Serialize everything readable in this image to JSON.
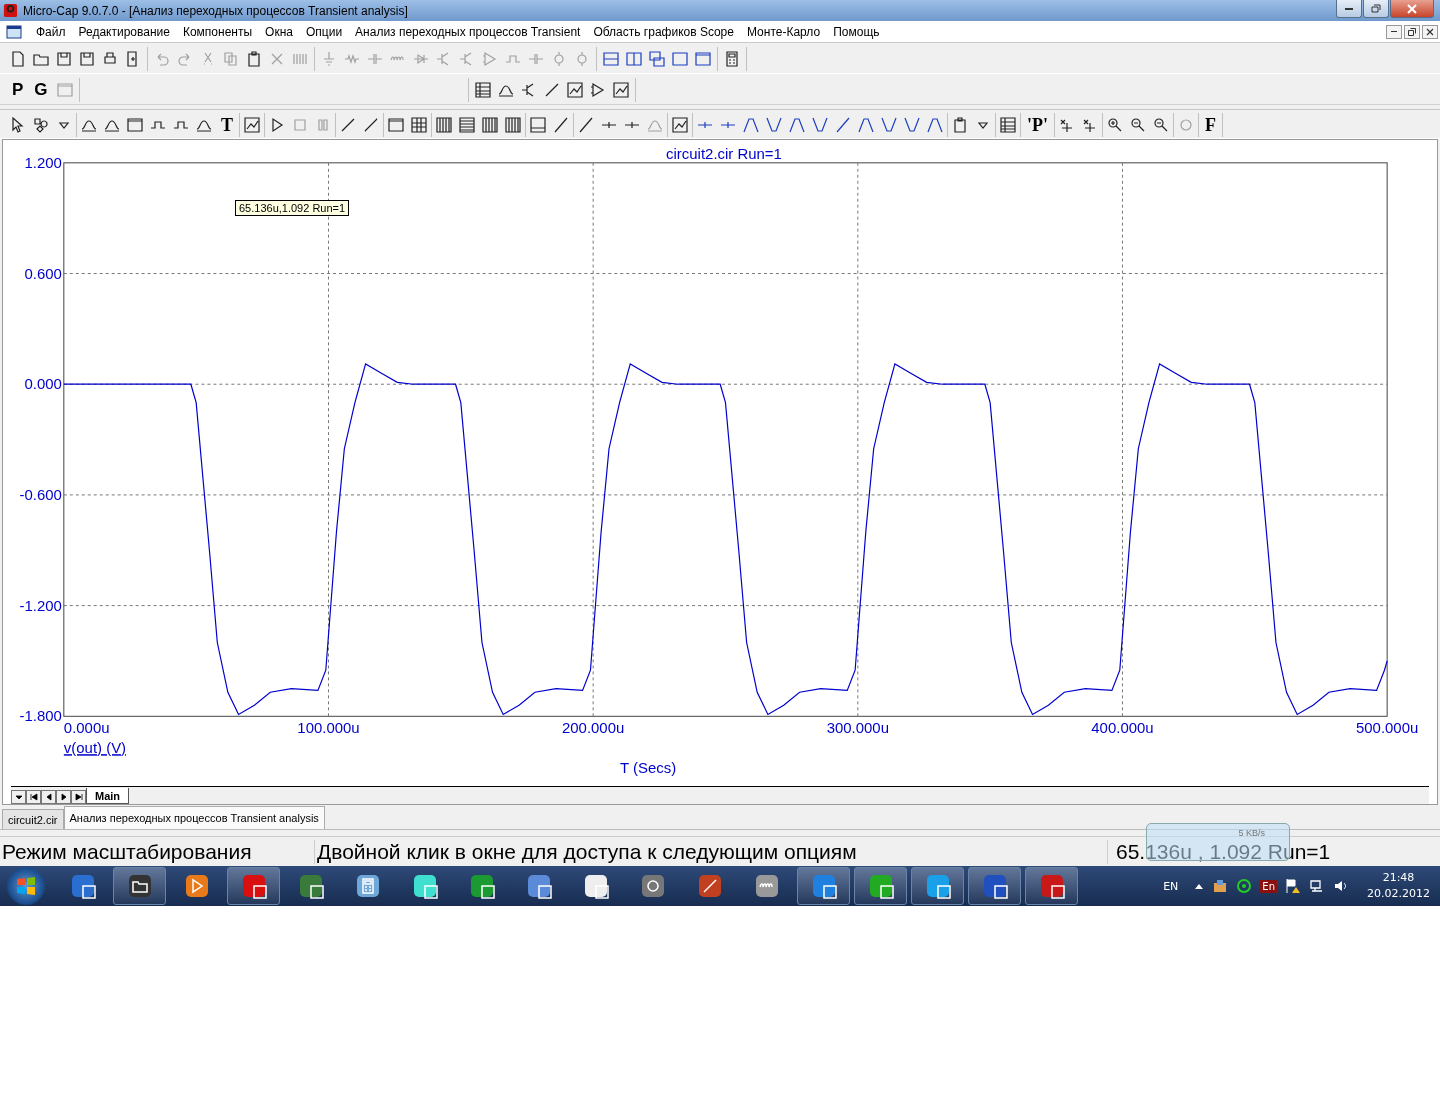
{
  "window": {
    "title": "Micro-Cap 9.0.7.0 - [Анализ переходных процессов Transient analysis]"
  },
  "menu": [
    "Файл",
    "Редактирование",
    "Компоненты",
    "Окна",
    "Опции",
    "Анализ переходных процессов Transient",
    "Область графиков Scope",
    "Монте-Карло",
    "Помощь"
  ],
  "mode_toolbar": {
    "buttons": [
      "P",
      "G"
    ]
  },
  "plot_toolbar": {
    "text_buttons": [
      "T",
      "'P'",
      "F"
    ]
  },
  "plot": {
    "tooltip": "65.136u,1.092 Run=1",
    "chart_data": {
      "type": "line",
      "title": "circuit2.cir Run=1",
      "xlabel": "T (Secs)",
      "x": [
        0,
        48,
        50,
        55,
        58,
        62,
        66,
        72,
        78,
        86,
        96,
        99,
        103,
        106,
        110,
        114,
        120,
        126,
        132,
        148,
        150,
        155,
        158,
        162,
        166,
        172,
        178,
        186,
        196,
        199,
        203,
        206,
        210,
        214,
        220,
        226,
        232,
        248,
        250,
        255,
        258,
        262,
        266,
        272,
        278,
        286,
        296,
        299,
        303,
        306,
        310,
        314,
        320,
        326,
        332,
        348,
        350,
        355,
        358,
        362,
        366,
        372,
        378,
        386,
        396,
        399,
        403,
        406,
        410,
        414,
        420,
        426,
        432,
        448,
        450,
        455,
        458,
        462,
        466,
        472,
        478,
        486,
        496,
        499,
        500
      ],
      "series": [
        {
          "name": "v(out) (V)",
          "color": "#0000cc",
          "values": [
            0,
            0,
            -0.1,
            -0.9,
            -1.4,
            -1.67,
            -1.79,
            -1.74,
            -1.67,
            -1.65,
            -1.66,
            -1.55,
            -0.8,
            -0.35,
            -0.1,
            0.11,
            0.06,
            0.01,
            0,
            0,
            -0.1,
            -0.9,
            -1.4,
            -1.67,
            -1.79,
            -1.74,
            -1.67,
            -1.65,
            -1.66,
            -1.55,
            -0.8,
            -0.35,
            -0.1,
            0.11,
            0.06,
            0.01,
            0,
            0,
            -0.1,
            -0.9,
            -1.4,
            -1.67,
            -1.79,
            -1.74,
            -1.67,
            -1.65,
            -1.66,
            -1.55,
            -0.8,
            -0.35,
            -0.1,
            0.11,
            0.06,
            0.01,
            0,
            0,
            -0.1,
            -0.9,
            -1.4,
            -1.67,
            -1.79,
            -1.74,
            -1.67,
            -1.65,
            -1.66,
            -1.55,
            -0.8,
            -0.35,
            -0.1,
            0.11,
            0.06,
            0.01,
            0,
            0,
            -0.1,
            -0.9,
            -1.4,
            -1.67,
            -1.79,
            -1.74,
            -1.67,
            -1.65,
            -1.66,
            -1.55,
            -1.5
          ]
        }
      ],
      "grid": true,
      "xlim": [
        0,
        500
      ],
      "ylim": [
        -1.8,
        1.2
      ],
      "xticks": [
        {
          "value": 0,
          "label": "0.000u"
        },
        {
          "value": 100,
          "label": "100.000u"
        },
        {
          "value": 200,
          "label": "200.000u"
        },
        {
          "value": 300,
          "label": "300.000u"
        },
        {
          "value": 400,
          "label": "400.000u"
        },
        {
          "value": 500,
          "label": "500.000u"
        }
      ],
      "yticks": [
        {
          "value": 1.2,
          "label": "1.200"
        },
        {
          "value": 0.6,
          "label": "0.600"
        },
        {
          "value": 0,
          "label": "0.000"
        },
        {
          "value": -0.6,
          "label": "-0.600"
        },
        {
          "value": -1.2,
          "label": "-1.200"
        },
        {
          "value": -1.8,
          "label": "-1.800"
        }
      ]
    }
  },
  "page_tabs": [
    {
      "label": "Main",
      "selected": true
    }
  ],
  "document_tabs": [
    {
      "label": "circuit2.cir",
      "selected": false
    },
    {
      "label": "Анализ переходных процессов Transient analysis",
      "selected": true
    }
  ],
  "status_bar": [
    "Режим масштабирования",
    "Двойной клик в окне для доступа к следующим опциям",
    "65.136u , 1.092  Run=1"
  ],
  "net_meter": {
    "reading": "5 KB/s"
  },
  "taskbar": {
    "apps": [
      {
        "running": false
      },
      {
        "running": true
      },
      {
        "running": false
      },
      {
        "running": true
      },
      {
        "running": false
      },
      {
        "running": false
      },
      {
        "running": false
      },
      {
        "running": false
      },
      {
        "running": false
      },
      {
        "running": false
      },
      {
        "running": false
      },
      {
        "running": false
      },
      {
        "running": false
      },
      {
        "running": true
      },
      {
        "running": true
      },
      {
        "running": true
      },
      {
        "running": true
      },
      {
        "running": true
      }
    ],
    "language": "EN",
    "tray_language": "En",
    "time": "21:48",
    "date": "20.02.2012"
  }
}
